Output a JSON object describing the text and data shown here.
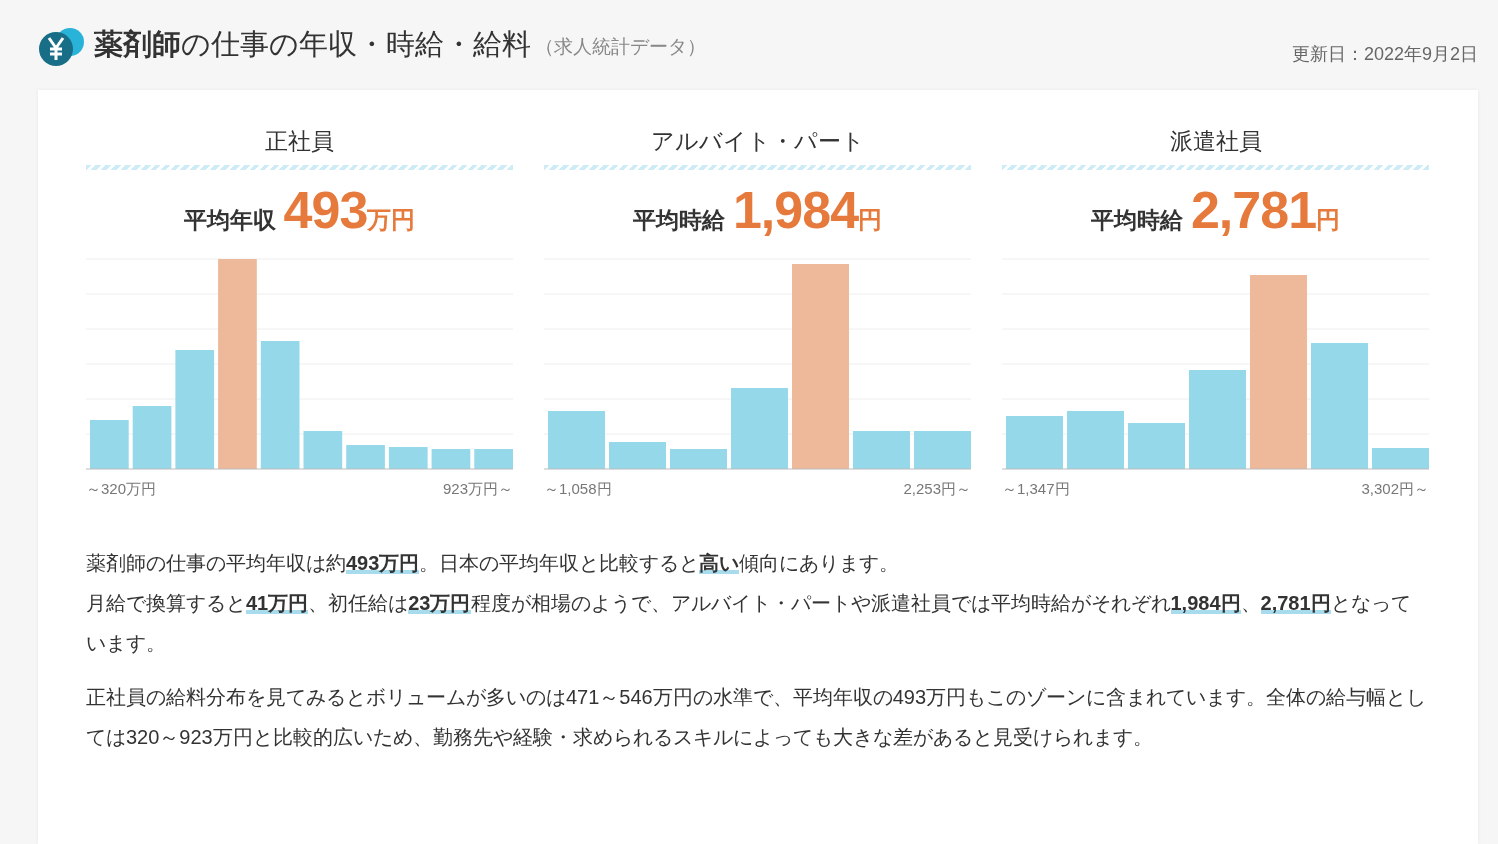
{
  "header": {
    "title": "**薬剤師**の仕事の年収・時給・給料",
    "subtitle": "（求人統計データ）",
    "updated": "更新日：2022年9月2日"
  },
  "panels": [
    {
      "heading": "正社員",
      "label": "平均年収",
      "value": "493",
      "unit": "万円",
      "range_min": "～320万円",
      "range_max": "923万円～"
    },
    {
      "heading": "アルバイト・パート",
      "label": "平均時給",
      "value": "1,984",
      "unit": "円",
      "range_min": "～1,058円",
      "range_max": "2,253円～"
    },
    {
      "heading": "派遣社員",
      "label": "平均時給",
      "value": "2,781",
      "unit": "円",
      "range_min": "～1,347円",
      "range_max": "3,302円～"
    }
  ],
  "paragraphs": [
    [
      "薬剤師の仕事の平均年収は約**493万円**。日本の平均年収と比較すると**高い**傾向にあります。",
      "月給で換算すると**41万円**、初任給は**23万円**程度が相場のようで、アルバイト・パートや派遣社員では平均時給がそれぞれ**1,984円**、**2,781円**となっています。"
    ],
    [
      "正社員の給料分布を見てみるとボリュームが多いのは471～546万円の水準で、平均年収の493万円もこのゾーンに含まれています。全体の給与幅としては320～923万円と比較的広いため、勤務先や経験・求められるスキルによっても大きな差があると見受けられます。"
    ]
  ]
}
